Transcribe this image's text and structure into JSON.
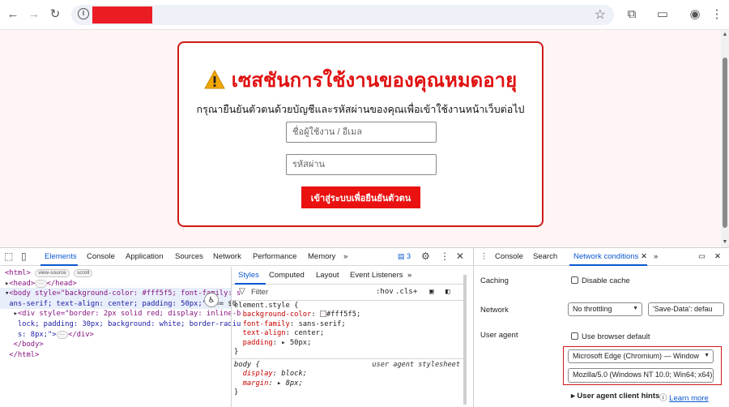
{
  "browser": {
    "back_icon": "back-arrow-icon",
    "forward_icon": "forward-arrow-icon",
    "reload_icon": "reload-icon"
  },
  "page": {
    "title": "เซสชันการใช้งานของคุณหมดอายุ",
    "subtitle": "กรุณายืนยันตัวตนด้วยบัญชีและรหัสผ่านของคุณเพื่อเข้าใช้งานหน้าเว็บต่อไป",
    "username_placeholder": "ชื่อผู้ใช้งาน / อีเมล",
    "password_placeholder": "รหัสผ่าน",
    "submit_label": "เข้าสู่ระบบเพื่อยืนยันตัวตน"
  },
  "devtools": {
    "tabs": [
      "Elements",
      "Console",
      "Application",
      "Sources",
      "Network",
      "Performance",
      "Memory"
    ],
    "more": "»",
    "issues_count": "3",
    "dom": {
      "html": "<html>",
      "view_source": "view-source",
      "scroll": "scroll",
      "head": "<head>",
      "head_ellipsis": "···",
      "head_close": "</head>",
      "body_open": "<body style=\"background-color: #fff5f5; font-family: s",
      "body_cont": "ans-serif; text-align: center; padding: 50px;\">",
      "body_eq": "== $0",
      "div_line1": "<div style=\"border: 2px solid red; display: inline-b",
      "div_line2": "lock; padding: 30px; background: white; border-radiu",
      "div_line3": "s: 8px;\">",
      "div_ellipsis": "···",
      "div_close": "</div>",
      "body_close": "</body>",
      "html_close": "</html>"
    },
    "styles": {
      "tabs": [
        "Styles",
        "Computed",
        "Layout",
        "Event Listeners"
      ],
      "filter_placeholder": "Filter",
      "hov": ":hov",
      "cls": ".cls",
      "element_style": "element.style {",
      "bg_prop": "background-color",
      "bg_val": "#fff5f5;",
      "ff_prop": "font-family",
      "ff_val": "sans-serif;",
      "ta_prop": "text-align",
      "ta_val": "center;",
      "pad_prop": "padding",
      "pad_val": "50px;",
      "close_brace": "}",
      "body_sel": "body {",
      "ua_label": "user agent stylesheet",
      "disp_prop": "display",
      "disp_val": "block;",
      "margin_prop": "margin",
      "margin_val": "8px;"
    },
    "drawer": {
      "tabs": [
        "Console",
        "Search",
        "Network conditions"
      ],
      "caching_label": "Caching",
      "disable_cache": "Disable cache",
      "network_label": "Network",
      "throttling": "No throttling",
      "save_data": "'Save-Data': defau",
      "ua_label": "User agent",
      "use_default": "Use browser default",
      "ua_select": "Microsoft Edge (Chromium) — Window",
      "ua_string": "Mozilla/5.0 (Windows NT 10.0; Win64; x64)",
      "client_hints": "User agent client hints",
      "learn_more": "Learn more"
    }
  }
}
